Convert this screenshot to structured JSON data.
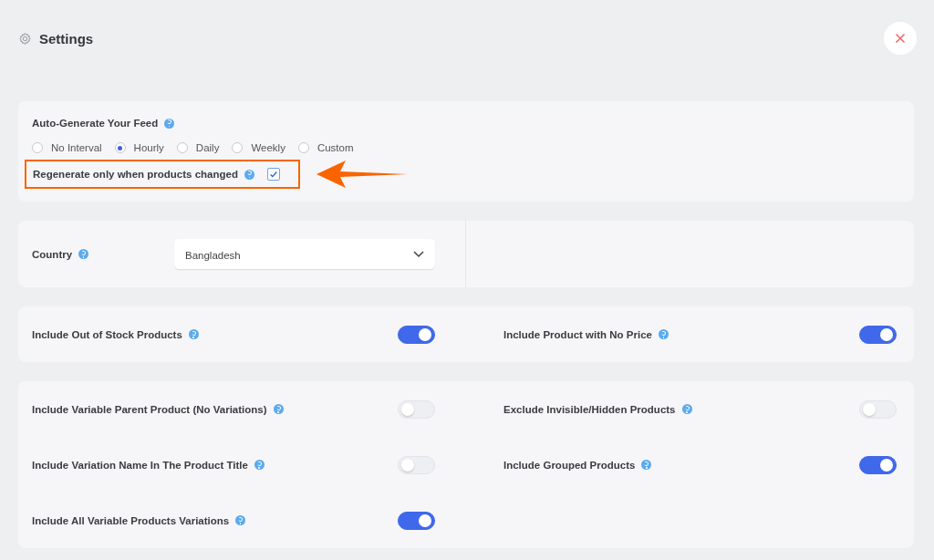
{
  "header": {
    "title": "Settings"
  },
  "auto_generate": {
    "label": "Auto-Generate Your Feed",
    "options": [
      {
        "label": "No Interval",
        "selected": false
      },
      {
        "label": "Hourly",
        "selected": true
      },
      {
        "label": "Daily",
        "selected": false
      },
      {
        "label": "Weekly",
        "selected": false
      },
      {
        "label": "Custom",
        "selected": false
      }
    ],
    "regenerate": {
      "label": "Regenerate only when products changed",
      "checked": true,
      "highlighted": true
    }
  },
  "country": {
    "label": "Country",
    "value": "Bangladesh"
  },
  "toggle_groups": [
    {
      "left": [
        {
          "label": "Include Out of Stock Products",
          "on": true
        }
      ],
      "right": [
        {
          "label": "Include Product with No Price",
          "on": true
        }
      ]
    },
    {
      "left": [
        {
          "label": "Include Variable Parent Product (No Variations)",
          "on": false
        },
        {
          "label": "Include Variation Name In The Product Title",
          "on": false
        },
        {
          "label": "Include All Variable Products Variations",
          "on": true
        }
      ],
      "right": [
        {
          "label": "Exclude Invisible/Hidden Products",
          "on": false
        },
        {
          "label": "Include Grouped Products",
          "on": true
        }
      ]
    }
  ]
}
